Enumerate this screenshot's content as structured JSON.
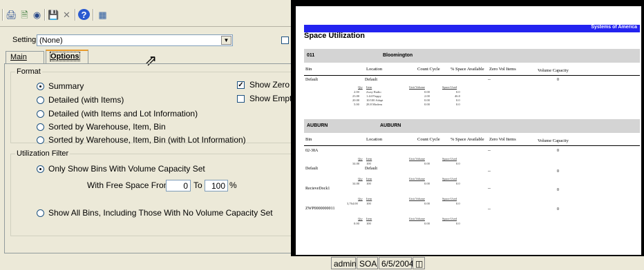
{
  "toolbar": {
    "icons": [
      "printer-icon",
      "print-preview-icon",
      "binoculars-icon",
      "save-icon",
      "delete-icon",
      "help-icon",
      "calendar-icon"
    ]
  },
  "setting": {
    "label": "Setting",
    "value": "(None)"
  },
  "tabs": [
    {
      "label": "Main"
    },
    {
      "label": "Options"
    }
  ],
  "format": {
    "title": "Format",
    "options": [
      {
        "label": "Summary",
        "selected": true
      },
      {
        "label": "Detailed (with Items)",
        "selected": false
      },
      {
        "label": "Detailed (with Items and Lot Information)",
        "selected": false
      },
      {
        "label": "Sorted by Warehouse, Item, Bin",
        "selected": false
      },
      {
        "label": "Sorted by Warehouse, Item, Bin (with Lot Information)",
        "selected": false
      }
    ],
    "checks": [
      {
        "label": "Show Zero Qty",
        "checked": true
      },
      {
        "label": "Show Empty B",
        "checked": false
      }
    ]
  },
  "filter": {
    "title": "Utilization Filter",
    "only_label": "Only Show Bins With Volume Capacity Set",
    "free_from_label": "With Free Space From",
    "from_value": "0",
    "to_label": "To",
    "to_value": "100",
    "pct": "%",
    "all_label": "Show All Bins, Including Those With No Volume Capacity Set"
  },
  "report": {
    "company": "Systems of America",
    "title": "Space Utilization",
    "headers": {
      "bin": "Bin",
      "location": "Location",
      "cycle": "Count Cycle",
      "space": "% Space Available",
      "zero": "Zero Vol Items",
      "capacity": "Volume Capacity"
    },
    "sub_headers": {
      "qty": "Qty",
      "item": "Item",
      "unit_volume": "Unit Volume",
      "space_used": "Space Used"
    },
    "groups": [
      {
        "code": "011",
        "name": "Bloomington"
      },
      {
        "code": "AUBURN",
        "name": "AUBURN"
      }
    ],
    "g1": {
      "bin": "Default",
      "location": "Default",
      "zero": "--",
      "capacity": "0",
      "rows": [
        {
          "qty": "2.00",
          "item": "2way Radio",
          "uv": "0.00",
          "su": "0.0"
        },
        {
          "qty": "23.00",
          "item": "1.44 Floppy",
          "uv": "2.00",
          "su": "46.0"
        },
        {
          "qty": "20.00",
          "item": "10/100 Adapt",
          "uv": "0.00",
          "su": "0.0"
        },
        {
          "qty": "5.00",
          "item": "28.8 Modem",
          "uv": "0.00",
          "su": "0.0"
        }
      ]
    },
    "g2": [
      {
        "bin": "02-38A",
        "location": "",
        "zero": "--",
        "capacity": "0",
        "qty": "34.00",
        "item": "100",
        "uv": "0.00",
        "su": "0.0"
      },
      {
        "bin": "Default",
        "location": "Default",
        "zero": "--",
        "capacity": "0",
        "qty": "34.00",
        "item": "100",
        "uv": "0.00",
        "su": "0.0"
      },
      {
        "bin": "RecieveDock1",
        "location": "",
        "zero": "--",
        "capacity": "0",
        "qty": "3,764.00",
        "item": "100",
        "uv": "0.00",
        "su": "0.0"
      },
      {
        "bin": "ZWP0000000011",
        "location": "",
        "zero": "--",
        "capacity": "0",
        "qty": "0.00",
        "item": "100",
        "uv": "0.00",
        "su": "0.0"
      }
    ]
  },
  "status": {
    "user": "admin",
    "company": "SOA",
    "date": "6/5/2004"
  }
}
